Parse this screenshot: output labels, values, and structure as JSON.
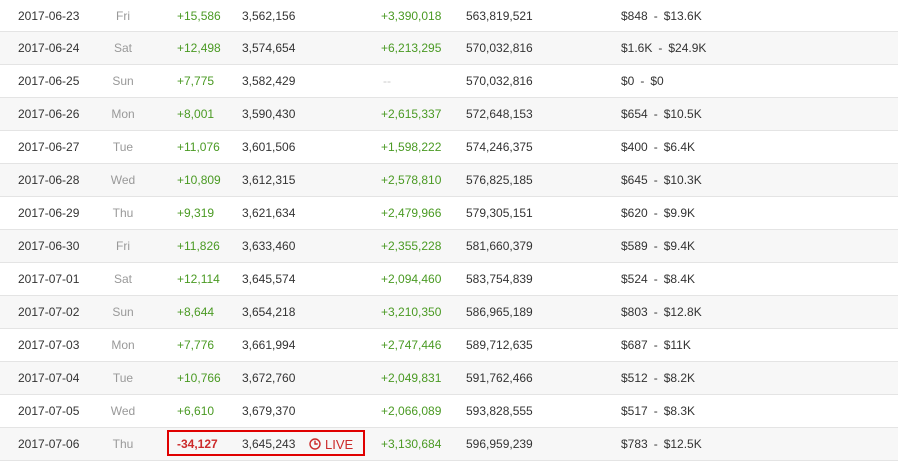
{
  "rows": [
    {
      "date": "2017-06-23",
      "day": "Fri",
      "sub_delta": "+15,586",
      "subs": "3,562,156",
      "view_delta": "+3,390,018",
      "views": "563,819,521",
      "earn_low": "$848",
      "earn_high": "$13.6K"
    },
    {
      "date": "2017-06-24",
      "day": "Sat",
      "sub_delta": "+12,498",
      "subs": "3,574,654",
      "view_delta": "+6,213,295",
      "views": "570,032,816",
      "earn_low": "$1.6K",
      "earn_high": "$24.9K"
    },
    {
      "date": "2017-06-25",
      "day": "Sun",
      "sub_delta": "+7,775",
      "subs": "3,582,429",
      "view_delta": "--",
      "views": "570,032,816",
      "earn_low": "$0",
      "earn_high": "$0"
    },
    {
      "date": "2017-06-26",
      "day": "Mon",
      "sub_delta": "+8,001",
      "subs": "3,590,430",
      "view_delta": "+2,615,337",
      "views": "572,648,153",
      "earn_low": "$654",
      "earn_high": "$10.5K"
    },
    {
      "date": "2017-06-27",
      "day": "Tue",
      "sub_delta": "+11,076",
      "subs": "3,601,506",
      "view_delta": "+1,598,222",
      "views": "574,246,375",
      "earn_low": "$400",
      "earn_high": "$6.4K"
    },
    {
      "date": "2017-06-28",
      "day": "Wed",
      "sub_delta": "+10,809",
      "subs": "3,612,315",
      "view_delta": "+2,578,810",
      "views": "576,825,185",
      "earn_low": "$645",
      "earn_high": "$10.3K"
    },
    {
      "date": "2017-06-29",
      "day": "Thu",
      "sub_delta": "+9,319",
      "subs": "3,621,634",
      "view_delta": "+2,479,966",
      "views": "579,305,151",
      "earn_low": "$620",
      "earn_high": "$9.9K"
    },
    {
      "date": "2017-06-30",
      "day": "Fri",
      "sub_delta": "+11,826",
      "subs": "3,633,460",
      "view_delta": "+2,355,228",
      "views": "581,660,379",
      "earn_low": "$589",
      "earn_high": "$9.4K"
    },
    {
      "date": "2017-07-01",
      "day": "Sat",
      "sub_delta": "+12,114",
      "subs": "3,645,574",
      "view_delta": "+2,094,460",
      "views": "583,754,839",
      "earn_low": "$524",
      "earn_high": "$8.4K"
    },
    {
      "date": "2017-07-02",
      "day": "Sun",
      "sub_delta": "+8,644",
      "subs": "3,654,218",
      "view_delta": "+3,210,350",
      "views": "586,965,189",
      "earn_low": "$803",
      "earn_high": "$12.8K"
    },
    {
      "date": "2017-07-03",
      "day": "Mon",
      "sub_delta": "+7,776",
      "subs": "3,661,994",
      "view_delta": "+2,747,446",
      "views": "589,712,635",
      "earn_low": "$687",
      "earn_high": "$11K"
    },
    {
      "date": "2017-07-04",
      "day": "Tue",
      "sub_delta": "+10,766",
      "subs": "3,672,760",
      "view_delta": "+2,049,831",
      "views": "591,762,466",
      "earn_low": "$512",
      "earn_high": "$8.2K"
    },
    {
      "date": "2017-07-05",
      "day": "Wed",
      "sub_delta": "+6,610",
      "subs": "3,679,370",
      "view_delta": "+2,066,089",
      "views": "593,828,555",
      "earn_low": "$517",
      "earn_high": "$8.3K"
    }
  ],
  "live_row": {
    "date": "2017-07-06",
    "day": "Thu",
    "sub_delta": "-34,127",
    "subs": "3,645,243",
    "live_label": "LIVE",
    "live_icon": "clock-icon",
    "view_delta": "+3,130,684",
    "views": "596,959,239",
    "earn_low": "$783",
    "earn_high": "$12.5K"
  },
  "earnings_separator": "-",
  "colors": {
    "positive": "#4a9a23",
    "negative": "#cc2a2a",
    "highlight": "#e00000",
    "muted": "#999999"
  }
}
